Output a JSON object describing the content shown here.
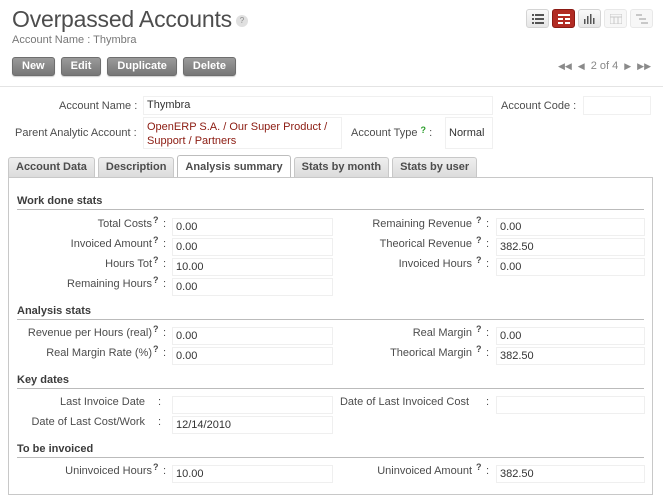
{
  "header": {
    "title": "Overpassed Accounts",
    "help": "?",
    "subtitle": "Account Name : Thymbra"
  },
  "toolbar": {
    "new_label": "New",
    "edit_label": "Edit",
    "duplicate_label": "Duplicate",
    "delete_label": "Delete"
  },
  "pager": {
    "text": "2 of 4"
  },
  "view_switch": [
    "list-view-icon",
    "form-view-icon",
    "graph-view-icon",
    "calendar-view-icon",
    "gantt-view-icon"
  ],
  "form": {
    "account_name_label": "Account Name :",
    "account_name_value": "Thymbra",
    "account_code_label": "Account Code :",
    "account_code_value": "",
    "parent_label": "Parent Analytic Account :",
    "parent_value_line1": "OpenERP S.A. / Our Super Product /",
    "parent_value_line2": "Support / Partners",
    "account_type_label": "Account Type",
    "account_type_help": "?",
    "account_type_colon": ":",
    "account_type_value": "Normal"
  },
  "tabs": [
    "Account Data",
    "Description",
    "Analysis summary",
    "Stats by month",
    "Stats by user"
  ],
  "sections": {
    "work_done": "Work done stats",
    "analysis": "Analysis stats",
    "key_dates": "Key dates",
    "to_invoice": "To be invoiced"
  },
  "fields": {
    "total_costs_label": "Total Costs",
    "total_costs": "0.00",
    "remaining_revenue_label": "Remaining Revenue",
    "remaining_revenue": "0.00",
    "invoiced_amount_label": "Invoiced Amount",
    "invoiced_amount": "0.00",
    "theorical_revenue_label": "Theorical Revenue",
    "theorical_revenue": "382.50",
    "hours_tot_label": "Hours Tot",
    "hours_tot": "10.00",
    "invoiced_hours_label": "Invoiced Hours",
    "invoiced_hours": "0.00",
    "remaining_hours_label": "Remaining Hours",
    "remaining_hours": "0.00",
    "revenue_per_hours_label": "Revenue per Hours (real)",
    "revenue_per_hours": "0.00",
    "real_margin_label": "Real Margin",
    "real_margin": "0.00",
    "real_margin_rate_label": "Real Margin Rate (%)",
    "real_margin_rate": "0.00",
    "theorical_margin_label": "Theorical Margin",
    "theorical_margin": "382.50",
    "last_invoice_date_label": "Last Invoice Date",
    "last_invoice_date": "",
    "date_last_invoiced_cost_label": "Date of Last Invoiced Cost",
    "date_last_invoiced_cost": "",
    "date_last_cost_work_label": "Date of Last Cost/Work",
    "date_last_cost_work": "12/14/2010",
    "uninvoiced_hours_label": "Uninvoiced Hours",
    "uninvoiced_hours": "10.00",
    "uninvoiced_amount_label": "Uninvoiced Amount",
    "uninvoiced_amount": "382.50",
    "help_mark": "?",
    "colon": ":"
  },
  "colors": {
    "accent": "#b12b23",
    "link": "#8b1a10",
    "help": "#2a9d2a"
  }
}
